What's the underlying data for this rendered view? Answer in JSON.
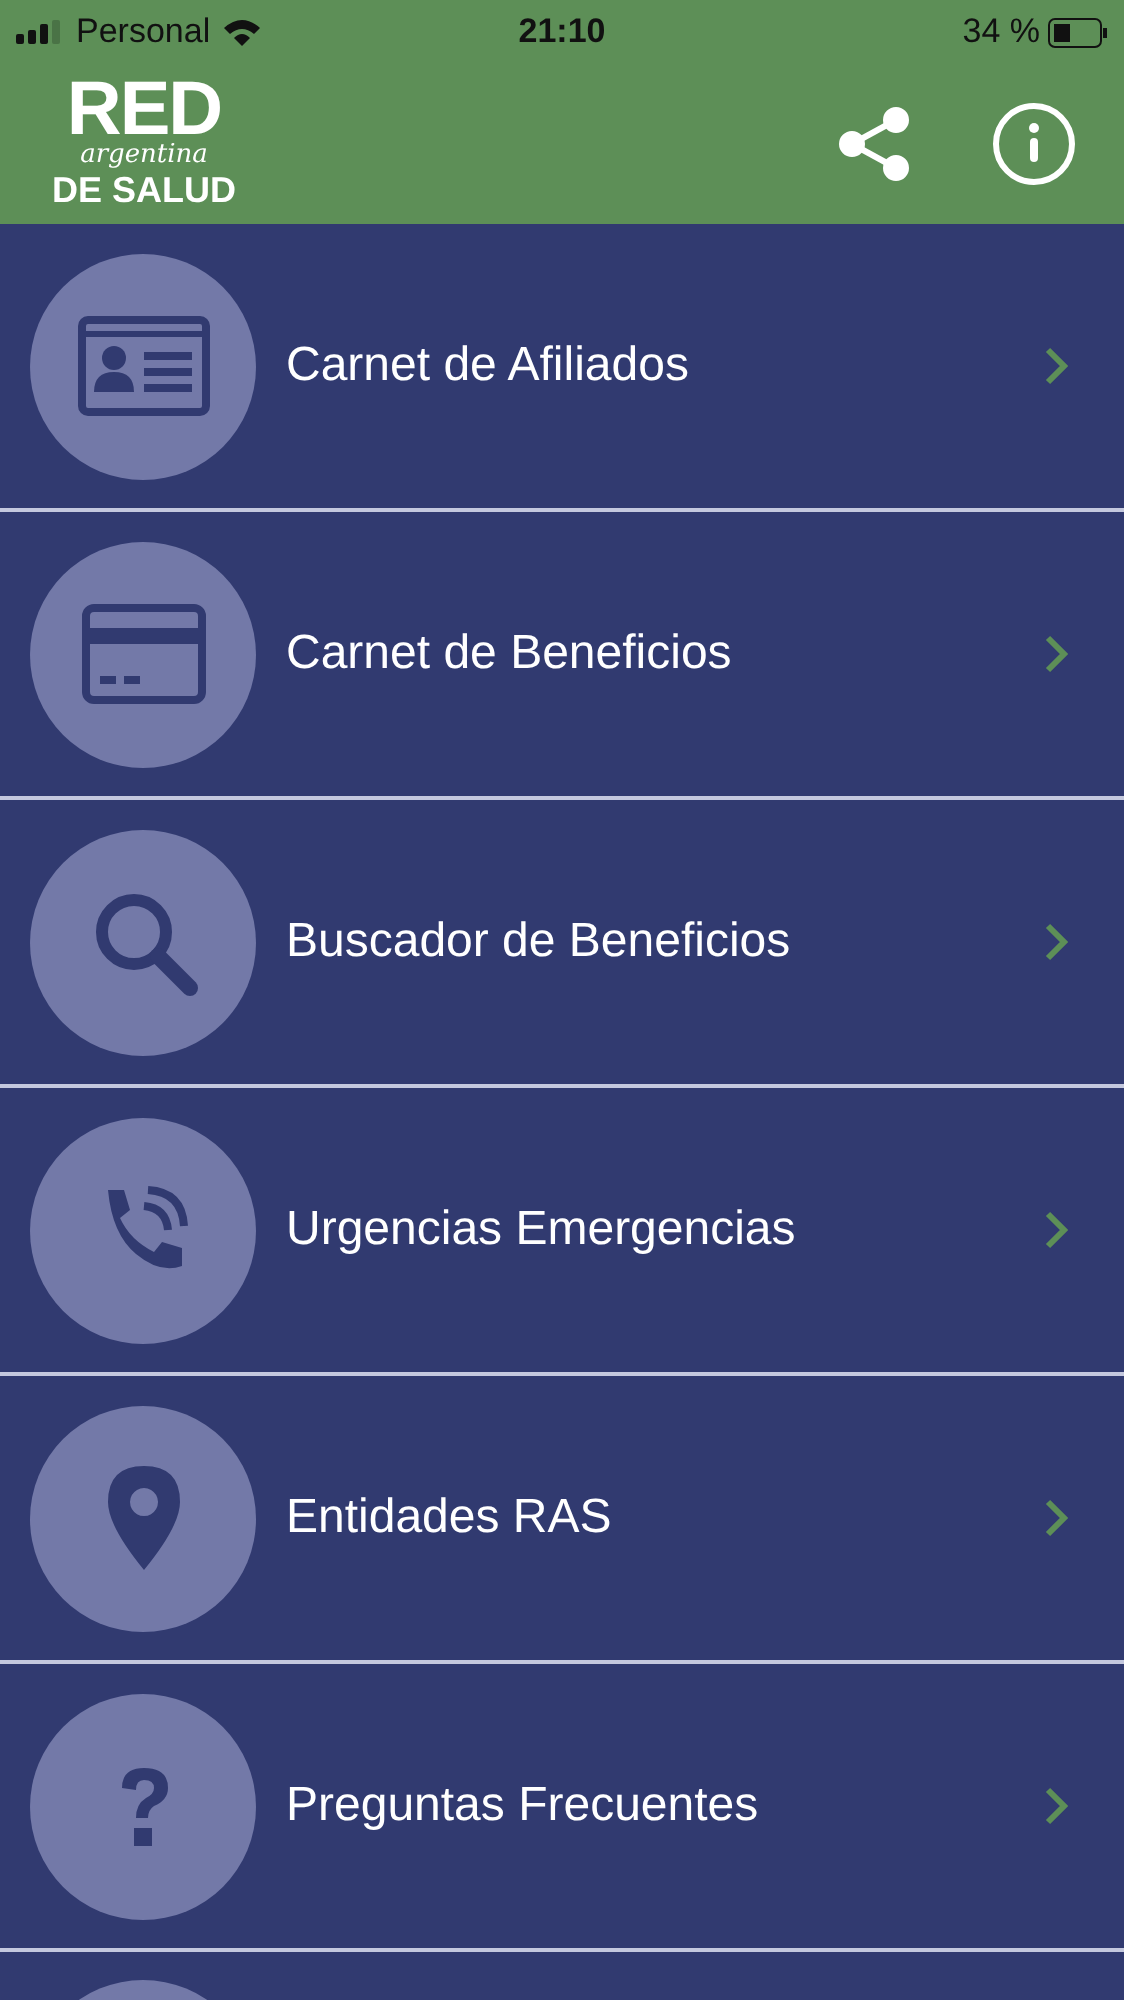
{
  "status_bar": {
    "carrier": "Personal",
    "time": "21:10",
    "battery": "34 %"
  },
  "header": {
    "logo": {
      "line_1": "RED",
      "line_2": "argentina",
      "line_3": "DE SALUD"
    }
  },
  "menu": [
    {
      "label": "Carnet de Afiliados"
    },
    {
      "label": "Carnet de Beneficios"
    },
    {
      "label": "Buscador de Beneficios"
    },
    {
      "label": "Urgencias Emergencias"
    },
    {
      "label": "Entidades RAS"
    },
    {
      "label": "Preguntas Frecuentes"
    }
  ]
}
